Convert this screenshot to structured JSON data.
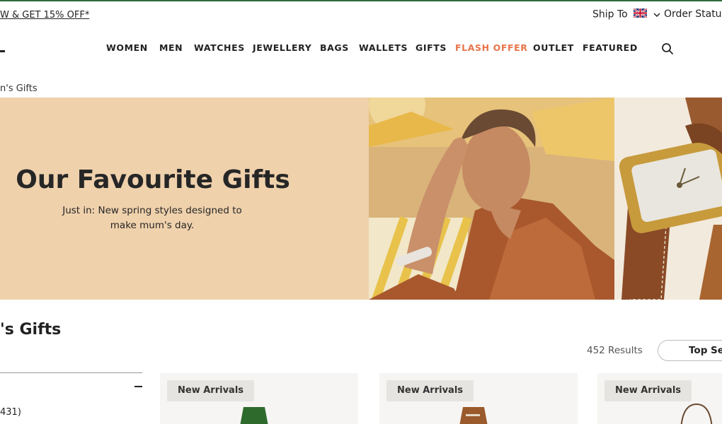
{
  "topbar": {
    "promo": "W & GET 15% OFF*",
    "ship_to": "Ship To",
    "order_status": "Order Status"
  },
  "nav": {
    "items": [
      {
        "label": "WOMEN"
      },
      {
        "label": "MEN"
      },
      {
        "label": "WATCHES"
      },
      {
        "label": "JEWELLERY"
      },
      {
        "label": "BAGS"
      },
      {
        "label": "WALLETS"
      },
      {
        "label": "GIFTS"
      },
      {
        "label": "FLASH OFFER",
        "highlight": true
      },
      {
        "label": "OUTLET"
      },
      {
        "label": "FEATURED"
      }
    ],
    "highlight_color": "#e8744a"
  },
  "breadcrumb": "n's Gifts",
  "hero": {
    "title": "Our Favourite Gifts",
    "subtitle": "Just in: New spring styles designed to make mum's day.",
    "background_color": "#efd1ac"
  },
  "listing": {
    "title": "'s Gifts",
    "results": "452 Results",
    "sort_label": "Top Sel",
    "filter_count": "431)"
  },
  "products": [
    {
      "badge": "New Arrivals"
    },
    {
      "badge": "New Arrivals"
    },
    {
      "badge": "New Arrivals"
    }
  ],
  "icons": {
    "search": "search-icon",
    "flag": "uk-flag-icon",
    "chevron": "chevron-down-icon",
    "minus": "minus-icon"
  }
}
